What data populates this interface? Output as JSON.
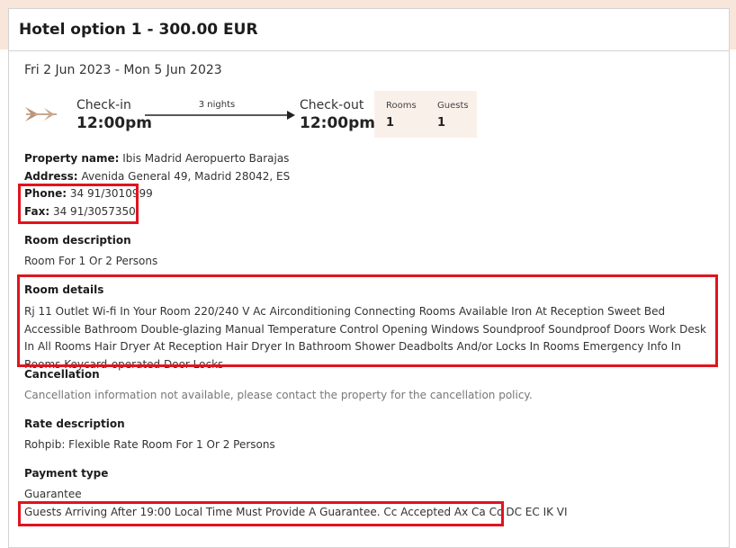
{
  "header": {
    "title": "Hotel option 1 - 300.00 EUR"
  },
  "stay": {
    "dates": "Fri 2 Jun 2023 - Mon 5 Jun 2023",
    "checkin_label": "Check-in",
    "checkin_time": "12:00pm",
    "nights": "3 nights",
    "checkout_label": "Check-out",
    "checkout_time": "12:00pm",
    "rooms_label": "Rooms",
    "rooms_value": "1",
    "guests_label": "Guests",
    "guests_value": "1"
  },
  "property": {
    "name_label": "Property name:",
    "name": "Ibis Madrid Aeropuerto Barajas",
    "address_label": "Address:",
    "address": "Avenida General 49, Madrid 28042, ES",
    "phone_label": "Phone:",
    "phone": "34 91/3010999",
    "fax_label": "Fax:",
    "fax": "34 91/3057350"
  },
  "room_description": {
    "heading": "Room description",
    "text": "Room For 1 Or 2 Persons"
  },
  "room_details": {
    "heading": "Room details",
    "text": "Rj 11 Outlet Wi-fi In Your Room 220/240 V Ac Airconditioning Connecting Rooms Available Iron At Reception Sweet Bed Accessible Bathroom Double-glazing Manual Temperature Control Opening Windows Soundproof Soundproof Doors Work Desk In All Rooms Hair Dryer At Reception Hair Dryer In Bathroom Shower Deadbolts And/or Locks In Rooms Emergency Info In Rooms Keycard-operated Door Locks"
  },
  "cancellation": {
    "heading": "Cancellation",
    "text": "Cancellation information not available, please contact the property for the cancellation policy."
  },
  "rate_description": {
    "heading": "Rate description",
    "text": "Rohpib: Flexible Rate Room For 1 Or 2 Persons"
  },
  "payment": {
    "heading": "Payment type",
    "type": "Guarantee",
    "text": "Guests Arriving After 19:00 Local Time Must Provide A Guarantee. Cc Accepted Ax Ca Cc DC EC IK VI"
  },
  "icons": {
    "plane": "plane-icon",
    "arrow": "arrow-right-icon"
  },
  "colors": {
    "highlight": "#e0141e",
    "accent_bg": "#faf0ea",
    "page_bg": "#f8e6db"
  }
}
